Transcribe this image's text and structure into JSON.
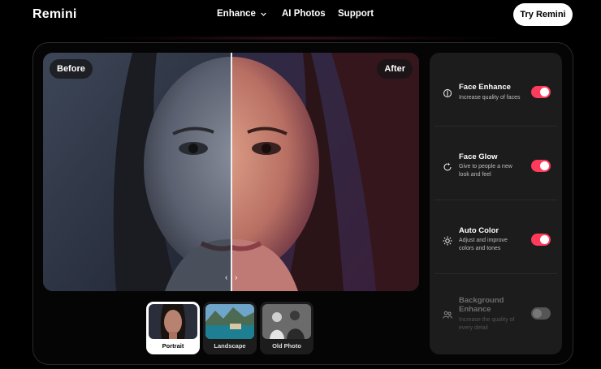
{
  "brand": {
    "logo": "Remini"
  },
  "nav": {
    "items": [
      {
        "label": "Enhance",
        "has_dropdown": true
      },
      {
        "label": "AI Photos"
      },
      {
        "label": "Support"
      }
    ],
    "cta_label": "Try Remini"
  },
  "compare": {
    "before_label": "Before",
    "after_label": "After",
    "handle_glyph": "‹ ›"
  },
  "presets": [
    {
      "label": "Portrait",
      "selected": true
    },
    {
      "label": "Landscape",
      "selected": false
    },
    {
      "label": "Old Photo",
      "selected": false
    }
  ],
  "features": [
    {
      "title": "Face Enhance",
      "description": "Increase quality of faces",
      "icon": "face-scan-icon",
      "enabled": true
    },
    {
      "title": "Face Glow",
      "description": "Give to people a new look and feel",
      "icon": "refresh-sparkle-icon",
      "enabled": true
    },
    {
      "title": "Auto Color",
      "description": "Adjust and improve colors and tones",
      "icon": "sun-icon",
      "enabled": true
    },
    {
      "title": "Background Enhance",
      "description": "Increase the quality of every detail",
      "icon": "people-icon",
      "enabled": false
    }
  ],
  "colors": {
    "accent": "#ff3b5c",
    "toggle_off": "#555555",
    "panel_bg": "#1c1c1c"
  }
}
